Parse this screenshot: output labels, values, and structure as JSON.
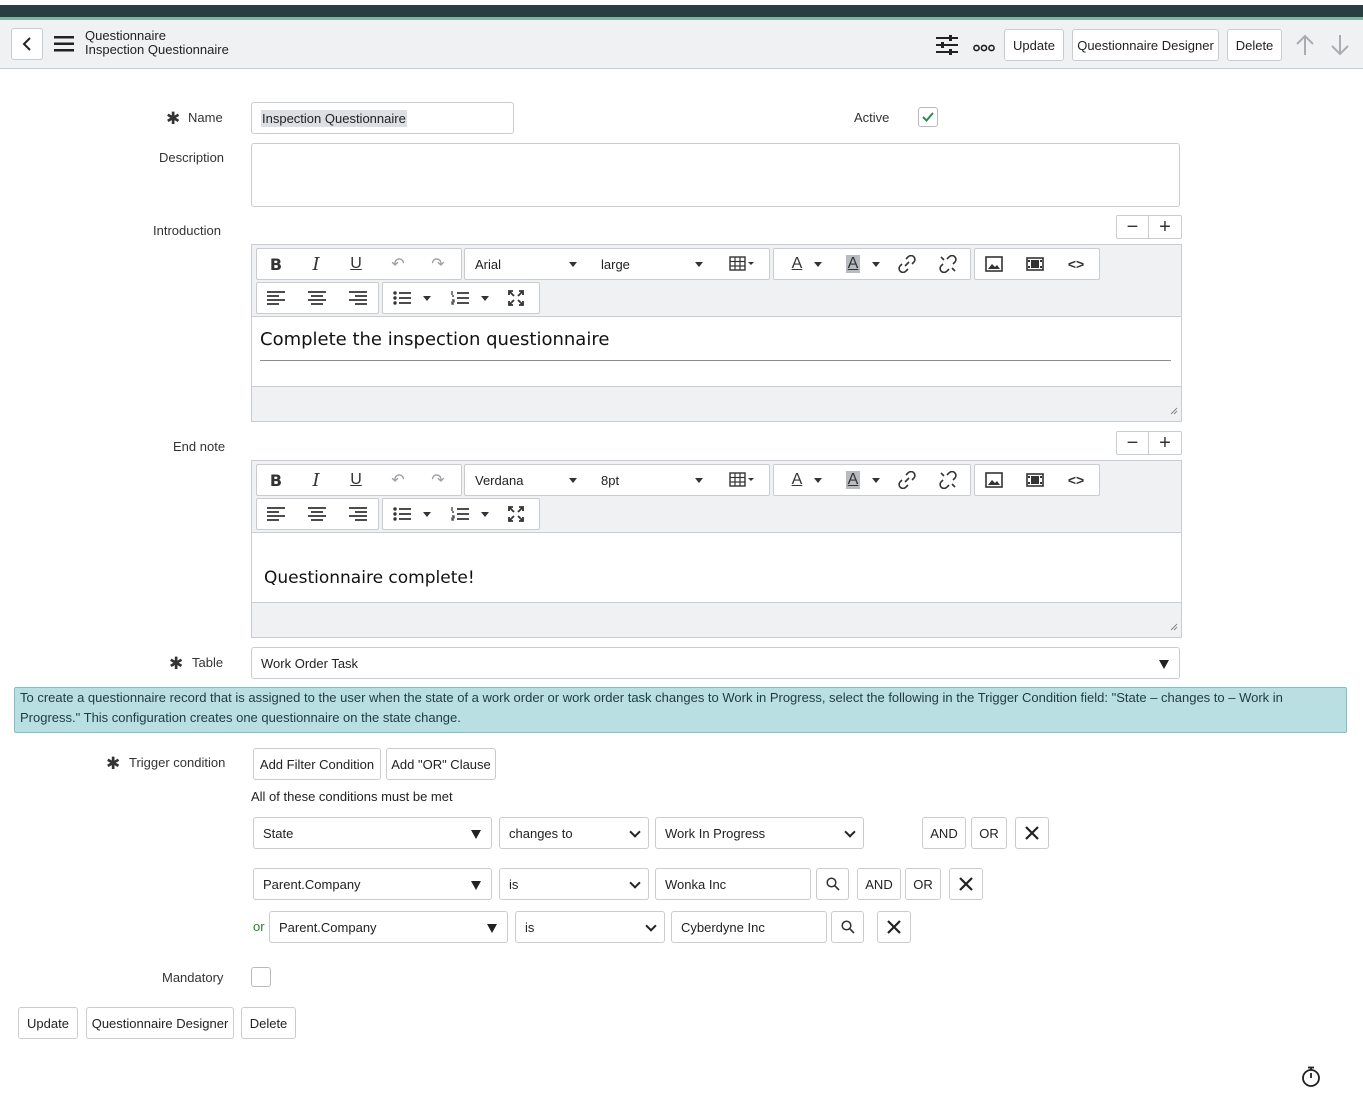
{
  "header": {
    "title_line1": "Questionnaire",
    "title_line2": "Inspection Questionnaire",
    "update_label": "Update",
    "designer_label": "Questionnaire Designer",
    "delete_label": "Delete"
  },
  "form": {
    "name_label": "Name",
    "name_value": "Inspection Questionnaire",
    "active_label": "Active",
    "active_checked": true,
    "description_label": "Description",
    "description_value": "",
    "introduction_label": "Introduction",
    "intro_font": "Arial",
    "intro_size": "large",
    "intro_text": "Complete the inspection questionnaire",
    "endnote_label": "End note",
    "endnote_font": "Verdana",
    "endnote_size": "8pt",
    "endnote_text": "Questionnaire complete!",
    "table_label": "Table",
    "table_value": "Work Order Task",
    "info_text": "To create a questionnaire record that is assigned to the user when the state of a work order or work order task changes to Work in Progress, select the following in the Trigger Condition field: \"State – changes to – Work in Progress.\" This configuration creates one questionnaire on the state change.",
    "trigger_label": "Trigger condition",
    "add_filter_label": "Add Filter Condition",
    "add_or_label": "Add \"OR\" Clause",
    "conditions_note": "All of these conditions must be met",
    "and_label": "AND",
    "or_label": "OR",
    "or_prefix": "or",
    "conditions": [
      {
        "field": "State",
        "operator": "changes to",
        "value": "Work In Progress"
      },
      {
        "field": "Parent.Company",
        "operator": "is",
        "value": "Wonka Inc"
      },
      {
        "field": "Parent.Company",
        "operator": "is",
        "value": "Cyberdyne Inc"
      }
    ],
    "mandatory_label": "Mandatory",
    "mandatory_checked": false
  },
  "footer": {
    "update_label": "Update",
    "designer_label": "Questionnaire Designer",
    "delete_label": "Delete"
  },
  "colors": {
    "header_bar": "#293e40",
    "info_bg": "#b9dfe3",
    "checkmark": "#2e8b57",
    "or_text": "#2e7d32"
  }
}
